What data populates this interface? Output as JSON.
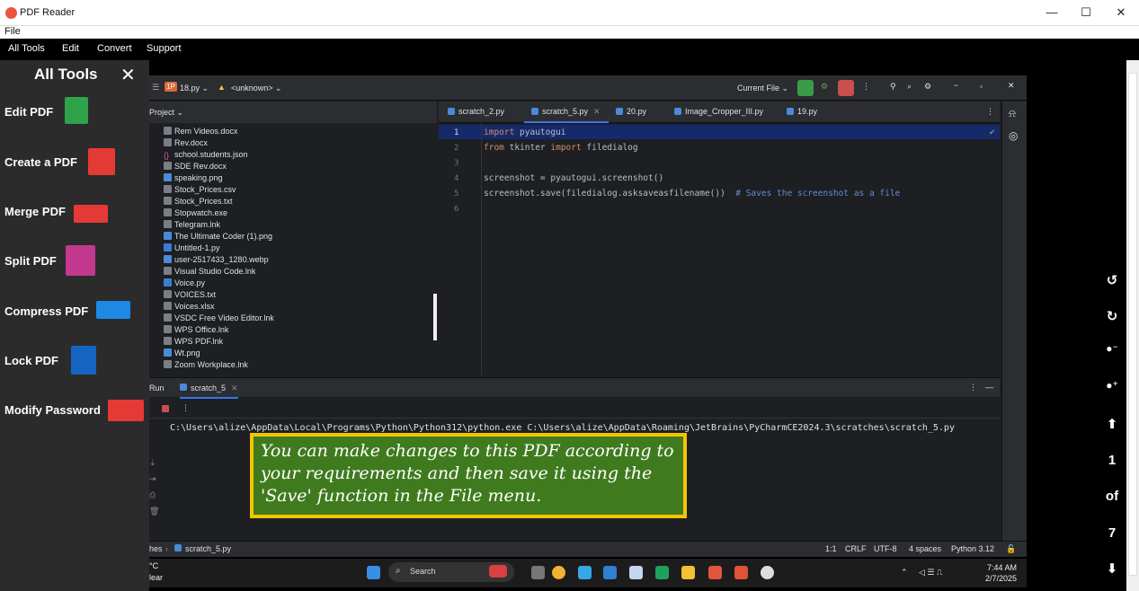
{
  "window": {
    "title": "PDF Reader",
    "minimize": "—",
    "maximize": "☐",
    "close": "✕"
  },
  "menubar": {
    "file": "File"
  },
  "toolbar_menu": [
    "All Tools",
    "Edit",
    "Convert",
    "Support"
  ],
  "tools_panel": {
    "title": "All Tools",
    "close": "✕",
    "items": [
      "Edit PDF",
      "Create a PDF",
      "Merge PDF",
      "Split PDF",
      "Compress PDF",
      "Lock PDF",
      "Modify Password"
    ]
  },
  "viewer_controls": {
    "page": "1",
    "of": "of",
    "total": "7"
  },
  "ide": {
    "project_badge": "1P",
    "project_file": "18.py ⌄",
    "vcs": "<unknown> ⌄",
    "run_config": "Current File ⌄",
    "project_header": "Project ⌄",
    "files": [
      "Rem Videos.docx",
      "Rev.docx",
      "school.students.json",
      "SDE Rev.docx",
      "speaking.png",
      "Stock_Prices.csv",
      "Stock_Prices.txt",
      "Stopwatch.exe",
      "Telegram.lnk",
      "The Ultimate Coder (1).png",
      "Untitled-1.py",
      "user-2517433_1280.webp",
      "Visual Studio Code.lnk",
      "Voice.py",
      "VOICES.txt",
      "Voices.xlsx",
      "VSDC Free Video Editor.lnk",
      "WPS Office.lnk",
      "WPS PDF.lnk",
      "Wt.png",
      "Zoom Workplace.lnk"
    ],
    "tabs": [
      "scratch_2.py",
      "scratch_5.py",
      "20.py",
      "Image_Cropper_III.py",
      "19.py"
    ],
    "line_numbers": [
      "1",
      "2",
      "3",
      "4",
      "5",
      "6"
    ],
    "code": {
      "l1_kw": "import",
      "l1_rest": " pyautogui",
      "l2_kw1": "from",
      "l2_mid": " tkinter ",
      "l2_kw2": "import",
      "l2_rest": " filedialog",
      "l4": "screenshot = pyautogui.screenshot()",
      "l5": "screenshot.save(filedialog.asksaveasfilename())",
      "l5_comment": "  # Saves the screenshot as a file"
    },
    "run_label": "Run",
    "run_tab": "scratch_5",
    "command": "C:\\Users\\alize\\AppData\\Local\\Programs\\Python\\Python312\\python.exe C:\\Users\\alize\\AppData\\Roaming\\JetBrains\\PyCharmCE2024.3\\scratches\\scratch_5.py",
    "status": {
      "breadcrumb_a": "hes",
      "breadcrumb_b": "scratch_5.py",
      "pos": "1:1",
      "eol": "CRLF",
      "enc": "UTF-8",
      "indent": "4 spaces",
      "interp": "Python 3.12"
    }
  },
  "taskbar": {
    "search": "Search",
    "time": "7:44 AM",
    "date": "2/7/2025",
    "weather_a": "°C",
    "weather_b": "lear"
  },
  "callout": {
    "text": "You can make changes to this PDF according to your requirements and then save it using the 'Save' function in the File menu."
  },
  "colors": {
    "callout_bg": "#3f7b1e",
    "callout_border": "#f5c400",
    "accent": "#3574f0"
  }
}
